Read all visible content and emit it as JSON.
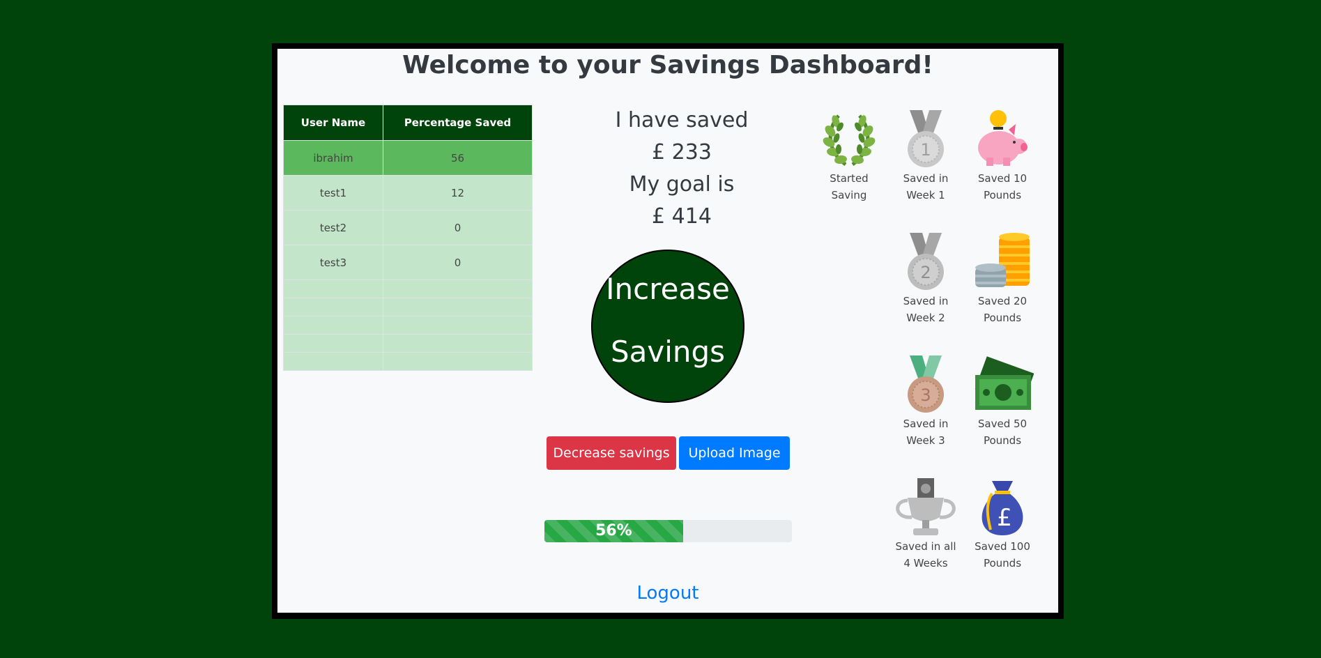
{
  "page": {
    "title": "Welcome to your Savings Dashboard!"
  },
  "leaderboard": {
    "headers": [
      "User Name",
      "Percentage Saved"
    ],
    "rows": [
      {
        "name": "ibrahim",
        "percent": "56"
      },
      {
        "name": "test1",
        "percent": "12"
      },
      {
        "name": "test2",
        "percent": "0"
      },
      {
        "name": "test3",
        "percent": "0"
      }
    ]
  },
  "summary": {
    "saved_label": "I have saved",
    "saved_amount": "£ 233",
    "goal_label": "My goal is",
    "goal_amount": "£ 414"
  },
  "increase_button": {
    "line1": "Increase",
    "line2": "Savings"
  },
  "buttons": {
    "decrease": "Decrease savings",
    "upload": "Upload Image"
  },
  "progress": {
    "value": 56,
    "label": "56%"
  },
  "logout": "Logout",
  "badges": [
    {
      "icon": "laurel-wreath-icon",
      "line1": "Started",
      "line2": "Saving"
    },
    {
      "icon": "medal-1-icon",
      "line1": "Saved in",
      "line2": "Week 1"
    },
    {
      "icon": "piggy-bank-icon",
      "line1": "Saved 10",
      "line2": "Pounds"
    },
    {
      "icon": "medal-2-icon",
      "line1": "Saved in",
      "line2": "Week 2"
    },
    {
      "icon": "coin-stack-icon",
      "line1": "Saved 20",
      "line2": "Pounds"
    },
    {
      "icon": "medal-3-icon",
      "line1": "Saved in",
      "line2": "Week 3"
    },
    {
      "icon": "banknotes-icon",
      "line1": "Saved 50",
      "line2": "Pounds"
    },
    {
      "icon": "trophy-icon",
      "line1": "Saved in all",
      "line2": "4 Weeks"
    },
    {
      "icon": "money-bag-icon",
      "line1": "Saved 100",
      "line2": "Pounds"
    }
  ],
  "colors": {
    "background": "#00440c",
    "table_header": "#00440c",
    "highlight_row": "#5cb85c",
    "row": "#c3e6cb",
    "danger": "#dc3545",
    "primary": "#007bff",
    "success": "#28a745"
  }
}
